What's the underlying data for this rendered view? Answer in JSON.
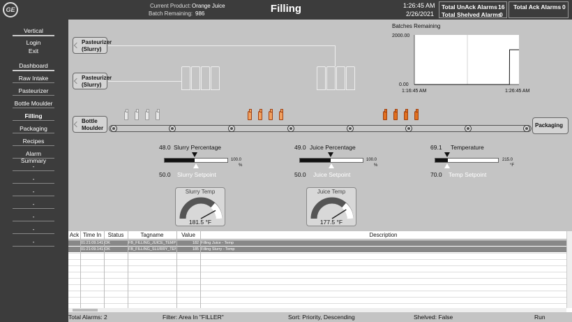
{
  "header": {
    "logo_text": "GE",
    "product_label": "Current Product:",
    "product_value": "Orange Juice",
    "batch_label": "Batch Remaining:",
    "batch_value": "986",
    "title": "Filling",
    "time": "1:26:45 AM",
    "date": "2/26/2021",
    "unack_label": "Total UnAck Alarms",
    "unack_value": "16",
    "shelved_label": "Total Shelved Alarms",
    "shelved_value": "0",
    "ack_label": "Total Ack Alarms",
    "ack_value": "0"
  },
  "sidebar": {
    "items": [
      "Vertical",
      "Login",
      "Exit",
      "Dashboard",
      "Raw Intake",
      "Pasteurizer",
      "Bottle Moulder",
      "Filling",
      "Packaging",
      "Recipes",
      "Alarm Summary",
      "-",
      "-",
      "-",
      "-",
      "-",
      "-",
      "-"
    ],
    "active": "Filling"
  },
  "process": {
    "pasteurizer1": "Pasteurizer\n(Slurry)",
    "pasteurizer2": "Pasteurizer\n(Slurry)",
    "bottle_moulder": "Bottle\nMoulder",
    "packaging": "Packaging"
  },
  "chart": {
    "title": "Batches Remaining",
    "y_max_label": "2000.00",
    "y_min_label": "0.00",
    "x_start_label": "1:16:45 AM",
    "x_end_label": "1:26:45 AM"
  },
  "chart_data": {
    "type": "line",
    "title": "Batches Remaining",
    "x": [
      "1:16:45 AM",
      "1:25:50 AM",
      "1:25:51 AM",
      "1:26:45 AM"
    ],
    "series": [
      {
        "values": [
          0,
          0,
          1400,
          1400
        ]
      }
    ],
    "ylim": [
      0,
      2000
    ],
    "grid": false
  },
  "sliders": {
    "slurry": {
      "pv": "48.0",
      "name": "Slurry Percentage",
      "sp": "50.0",
      "sp_name": "Slurry Setpoint",
      "max": "100.0",
      "unit": "%",
      "pv_frac": 0.48,
      "sp_frac": 0.5
    },
    "juice": {
      "pv": "49.0",
      "name": "Juice Percentage",
      "sp": "50.0",
      "sp_name": "Juice Setpoint",
      "max": "100.0",
      "unit": "%",
      "pv_frac": 0.49,
      "sp_frac": 0.5
    },
    "temp": {
      "pv": "69.1",
      "name": "Temperature",
      "sp": "70.0",
      "sp_name": "Temp Setpoint",
      "max": "215.0",
      "unit": "°F",
      "pv_frac": 0.2,
      "sp_frac": 0.2
    }
  },
  "gauges": {
    "slurry": {
      "title": "Slurry Temp",
      "value": "181.5 °F",
      "frac": 0.84
    },
    "juice": {
      "title": "Juice Temp",
      "value": "177.5 °F",
      "frac": 0.82
    }
  },
  "alarms": {
    "columns": [
      "Ack",
      "Time In",
      "Status",
      "Tagname",
      "Value",
      "Description"
    ],
    "rows": [
      {
        "time": "01:21:09.141",
        "status": "OK",
        "tag": "FB_FILLING_JUICE_TEMP",
        "value": "182",
        "desc": "Filling Juice - Temp"
      },
      {
        "time": "01:21:09.141",
        "status": "OK",
        "tag": "FB_FILLING_SLURRY_TEM",
        "value": "185",
        "desc": "Filling Slurry - Temp"
      }
    ]
  },
  "status": {
    "total": "Total Alarms: 2",
    "filter": "Filter: Area In \"FILLER\"",
    "sort": "Sort: Priority, Descending",
    "shelved": "Shelved: False",
    "run": "Run"
  },
  "colors": {
    "header_bg": "#3c3c3c",
    "main_bg": "#c4c4c4",
    "juice": "#e07020"
  }
}
